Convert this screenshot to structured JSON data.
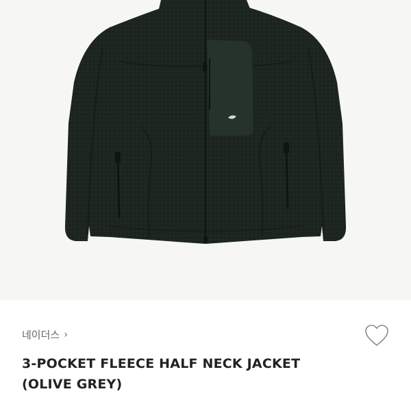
{
  "product": {
    "image_alt": "",
    "brand": "네이더스",
    "title_line1": "3-POCKET FLEECE HALF NECK JACKET",
    "title_line2": "(OLIVE GREY)"
  },
  "icons": {
    "brand_chevron": "chevron-right-icon",
    "wishlist": "heart-outline-icon"
  },
  "colors": {
    "jacket": "#1c2520",
    "background": "#f6f6f4",
    "text_primary": "#222222",
    "text_secondary": "#666666"
  }
}
